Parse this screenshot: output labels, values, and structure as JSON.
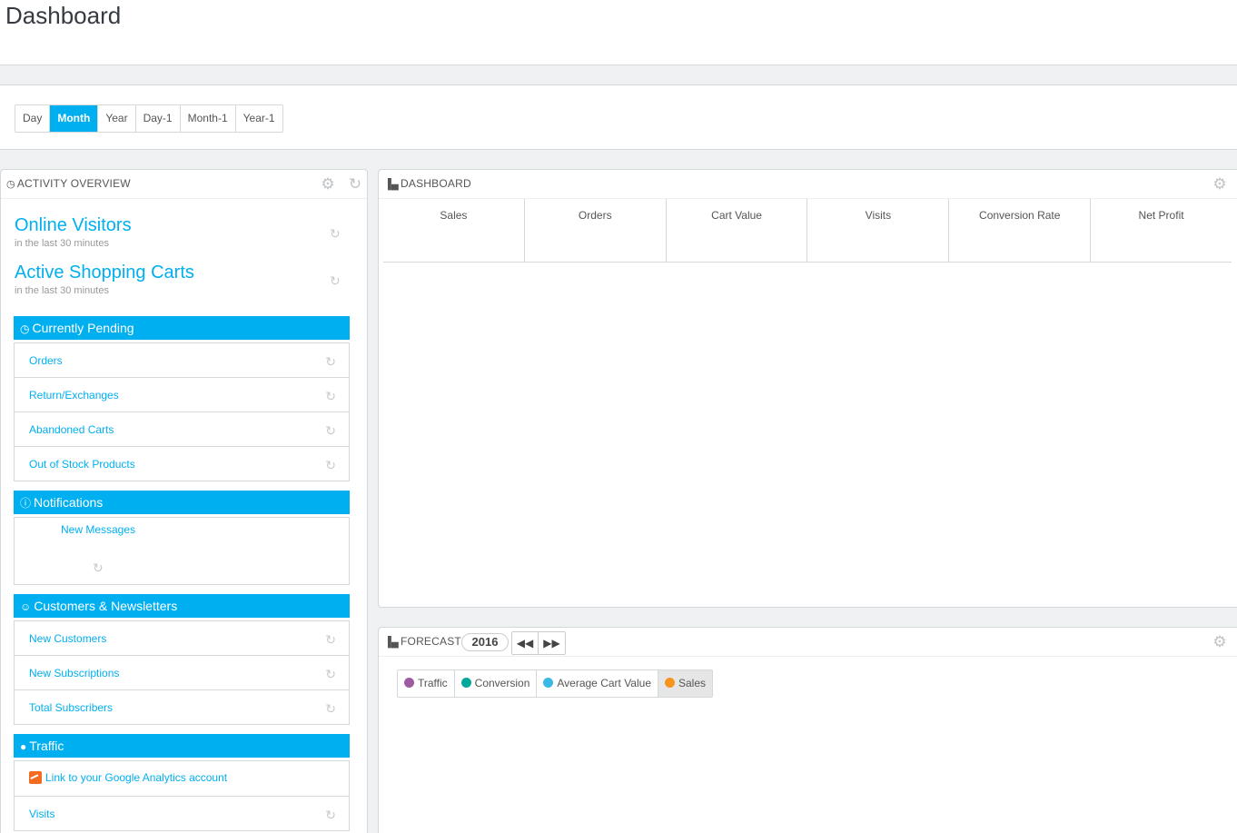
{
  "header": {
    "title": "Dashboard"
  },
  "periods": [
    {
      "label": "Day",
      "active": false
    },
    {
      "label": "Month",
      "active": true
    },
    {
      "label": "Year",
      "active": false
    },
    {
      "label": "Day-1",
      "active": false
    },
    {
      "label": "Month-1",
      "active": false
    },
    {
      "label": "Year-1",
      "active": false
    }
  ],
  "activity": {
    "title": "ACTIVITY OVERVIEW",
    "online_visitors": {
      "title": "Online Visitors",
      "subtitle": "in the last 30 minutes"
    },
    "active_carts": {
      "title": "Active Shopping Carts",
      "subtitle": "in the last 30 minutes"
    },
    "pending": {
      "title": "Currently Pending",
      "items": [
        "Orders",
        "Return/Exchanges",
        "Abandoned Carts",
        "Out of Stock Products"
      ]
    },
    "notifications": {
      "title": "Notifications",
      "items": [
        "New Messages"
      ]
    },
    "customers": {
      "title": "Customers & Newsletters",
      "items": [
        "New Customers",
        "New Subscriptions",
        "Total Subscribers"
      ]
    },
    "traffic": {
      "title": "Traffic",
      "ga_link": "Link to your Google Analytics account",
      "items": [
        "Visits"
      ]
    }
  },
  "dashboard": {
    "title": "DASHBOARD",
    "columns": [
      "Sales",
      "Orders",
      "Cart Value",
      "Visits",
      "Conversion Rate",
      "Net Profit"
    ]
  },
  "forecast": {
    "title": "FORECAST",
    "year": "2016",
    "nav": {
      "prev": "◀◀",
      "next": "▶▶"
    },
    "legend": [
      {
        "label": "Traffic",
        "color": "#9e5ba1",
        "active": false
      },
      {
        "label": "Conversion",
        "color": "#00a89c",
        "active": false
      },
      {
        "label": "Average Cart Value",
        "color": "#3ab9e6",
        "active": false
      },
      {
        "label": "Sales",
        "color": "#f7941e",
        "active": true
      }
    ]
  },
  "icons": {
    "clock": "clock-icon",
    "gear": "gear-icon",
    "refresh": "refresh-icon",
    "bar_chart": "bar-chart-icon",
    "exclamation": "exclamation-icon",
    "user": "user-icon",
    "globe": "globe-icon"
  }
}
